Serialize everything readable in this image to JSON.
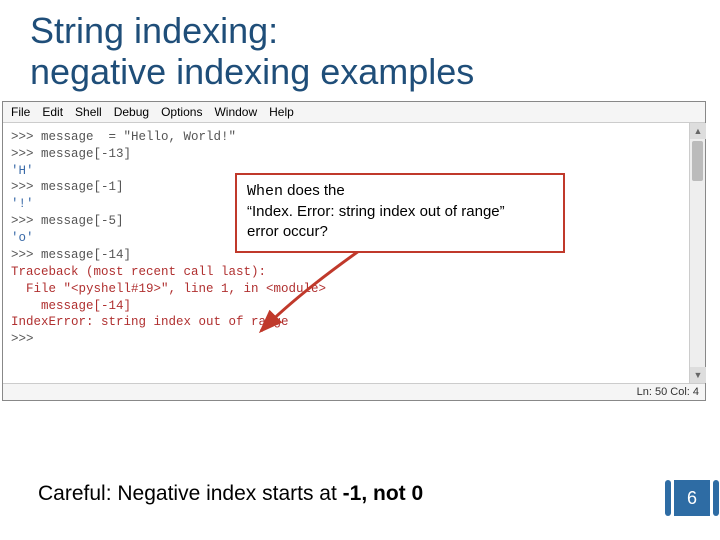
{
  "title_line1": "String indexing:",
  "title_line2": "negative indexing examples",
  "menubar": [
    "File",
    "Edit",
    "Shell",
    "Debug",
    "Options",
    "Window",
    "Help"
  ],
  "code_lines": [
    {
      "cls": "prompt",
      "t": ">>> message  = \"Hello, World!\""
    },
    {
      "cls": "prompt",
      "t": ">>> message[-13]"
    },
    {
      "cls": "output",
      "t": "'H'"
    },
    {
      "cls": "prompt",
      "t": ">>> message[-1]"
    },
    {
      "cls": "output",
      "t": "'!'"
    },
    {
      "cls": "prompt",
      "t": ">>> message[-5]"
    },
    {
      "cls": "output",
      "t": "'o'"
    },
    {
      "cls": "prompt",
      "t": ">>> message[-14]"
    },
    {
      "cls": "error",
      "t": "Traceback (most recent call last):"
    },
    {
      "cls": "error",
      "t": "  File \"<pyshell#19>\", line 1, in <module>"
    },
    {
      "cls": "error",
      "t": "    message[-14]"
    },
    {
      "cls": "error",
      "t": "IndexError: string index out of range"
    },
    {
      "cls": "prompt",
      "t": ">>> "
    }
  ],
  "callout": {
    "l1a": "When",
    "l1b": " does the",
    "l2": "“Index. Error: string index out of range”",
    "l3": "error occur?"
  },
  "statusbar": "Ln: 50  Col: 4",
  "bottom_note_a": "Careful: Negative index starts at ",
  "bottom_note_b": "-1, not 0",
  "page_number": "6"
}
